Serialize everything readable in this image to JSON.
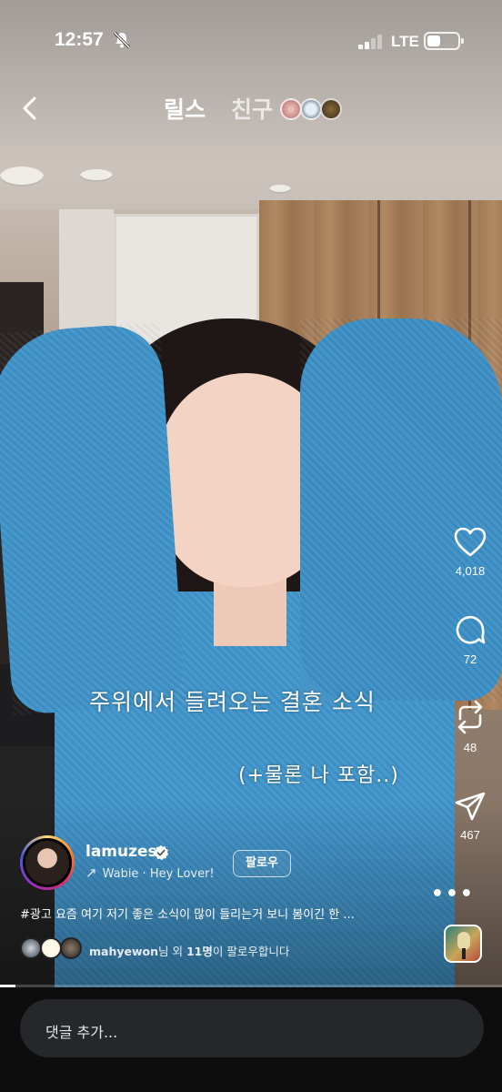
{
  "status_bar": {
    "time": "12:57",
    "network": "LTE",
    "battery_level": 0.45,
    "icons": [
      "silent-bell-icon",
      "signal-icon",
      "battery-icon"
    ]
  },
  "header": {
    "tabs": [
      {
        "label": "릴스",
        "active": true
      },
      {
        "label": "친구",
        "active": false
      }
    ]
  },
  "video_captions": {
    "line1": "주위에서 들려오는 결혼 소식",
    "line2": "(+물론 나 포함..)"
  },
  "actions": {
    "likes": "4,018",
    "comments": "72",
    "reposts": "48",
    "shares": "467"
  },
  "author": {
    "username": "lamuzes",
    "audio": "Wabie · Hey Lover!",
    "follow_label": "팔로우"
  },
  "description": "#광고 요즘 여기 저기 좋은 소식이 많이 들리는거 보니 봄이긴 한 ...",
  "followed_by": {
    "name": "mahyewon",
    "mid": "님 외 ",
    "count": "11명",
    "suffix": "이 팔로우합니다"
  },
  "video_progress": 0.03,
  "comment_bar": {
    "placeholder": "댓글 추가..."
  },
  "colors": {
    "accent_cardigan": "#3f95cc",
    "comment_box": "#26272b"
  }
}
